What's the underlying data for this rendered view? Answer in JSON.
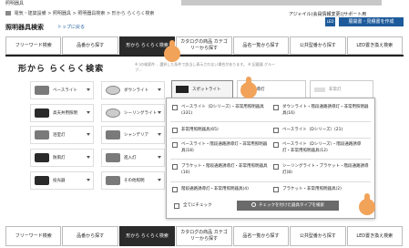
{
  "site": {
    "brand": "照明器具"
  },
  "breadcrumb": [
    "電気・建築設備",
    "照明器具",
    "照明器具検索",
    "形から らくらく検索"
  ],
  "header": {
    "user": "アジャイル(会員情報変更)|サポート用",
    "led_badge": "LED",
    "create_button": "展開書・見積書を作成",
    "title": "照明器具検索",
    "back_link": "トップに戻る"
  },
  "tabs": [
    {
      "label": "フリーワード検索"
    },
    {
      "label": "品番から探す"
    },
    {
      "label": "形から らくらく検索"
    },
    {
      "label": "カタログの商品 カテゴリーから探す"
    },
    {
      "label": "品名一覧から探す"
    },
    {
      "label": "公共型番から探す"
    },
    {
      "label": "LED置き換え検索"
    }
  ],
  "search": {
    "heading": "形から らくらく検索",
    "note": "※ (の検索件... 選択した条件で該当し表示されない場合があります。 ※ 記載器 グループ..."
  },
  "categories": [
    {
      "label": "ベースライト",
      "icon": "base-light-icon"
    },
    {
      "label": "ダウンライト",
      "icon": "downlight-icon"
    },
    {
      "label": "高天井用照明",
      "icon": "high-ceiling-icon"
    },
    {
      "label": "シーリングライト",
      "icon": "ceiling-light-icon"
    },
    {
      "label": "浴室灯",
      "icon": "bathroom-light-icon"
    },
    {
      "label": "シャンデリア",
      "icon": "chandelier-icon"
    },
    {
      "label": "防雨灯",
      "icon": "rainproof-light-icon"
    },
    {
      "label": "進入灯",
      "icon": "approach-light-icon"
    },
    {
      "label": "投光器",
      "icon": "floodlight-icon"
    },
    {
      "label": "その他照明",
      "icon": "other-light-icon"
    }
  ],
  "top_selectors": [
    {
      "label": "スポットライト",
      "icon": "spotlight-icon"
    },
    {
      "label": "誘導灯",
      "icon": "exit-sign-icon"
    },
    {
      "label": "非常灯",
      "icon": "emergency-light-icon"
    }
  ],
  "dropdown": {
    "options": [
      "ベースライト（Dシリーズ）・非常用照明器具(331)",
      "ダウンライト・階段通路誘導灯・非常用照明器具(16)",
      "非常用照明器具(65)",
      "ベースライト（Dシリーズ）(21)",
      "ベースライト・階段通路誘導灯・非常用照明器具(18)",
      "ベースライト（Dシリーズ）・階段通路誘導灯・非常用照明器具(12)",
      "ブラケット・階段通路誘導灯・非常用照明器具(10)",
      "シーリングライト・ブラケット・階段通路誘導灯(8)",
      "階段通路誘導灯・非常用照明器具(4)",
      "ブラケット・非常用照明器具(2)"
    ],
    "check_all": "全てにチェック",
    "search_button": "チェックを付けた器具タイプを検索"
  }
}
